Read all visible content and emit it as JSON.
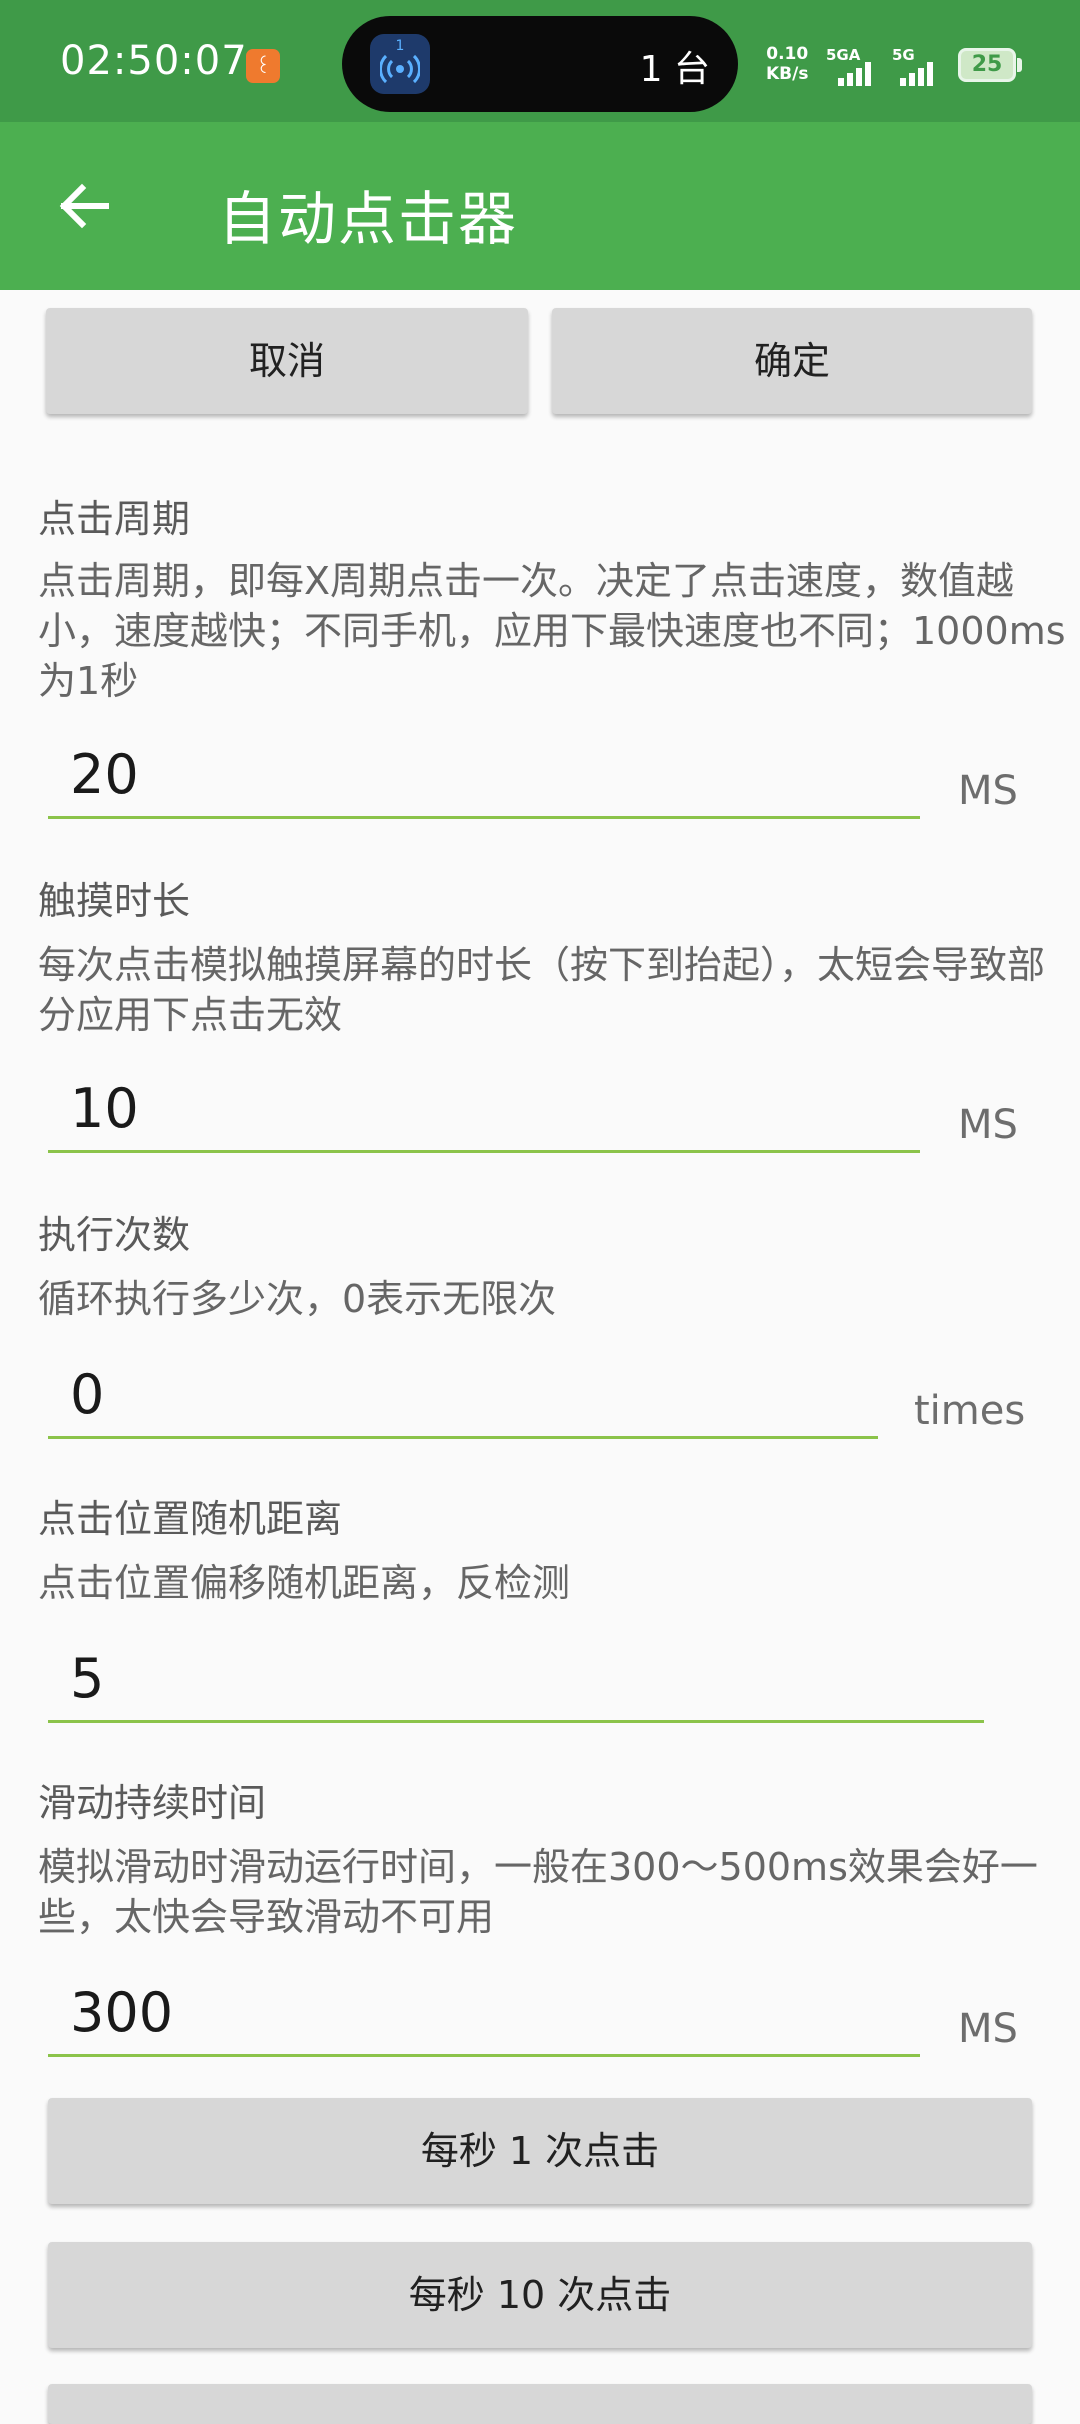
{
  "status_bar": {
    "time": "02:50:07",
    "app_icon_glyph": "꒰",
    "pill_badge": "1",
    "pill_text": "1 台",
    "net_speed_value": "0.10",
    "net_speed_unit": "KB/s",
    "sim1_label": "5GA",
    "sim2_label": "5G",
    "battery": "25"
  },
  "app_bar": {
    "title": "自动点击器",
    "back_icon": "arrow-back-icon"
  },
  "actions": {
    "cancel_label": "取消",
    "ok_label": "确定"
  },
  "settings": {
    "click_period": {
      "label": "点击周期",
      "description": "点击周期，即每X周期点击一次。决定了点击速度，数值越小，速度越快；不同手机，应用下最快速度也不同；1000ms为1秒",
      "value": "20",
      "unit": "MS"
    },
    "touch_duration": {
      "label": "触摸时长",
      "description": "每次点击模拟触摸屏幕的时长（按下到抬起），太短会导致部分应用下点击无效",
      "value": "10",
      "unit": "MS"
    },
    "repeat_count": {
      "label": "执行次数",
      "description": "循环执行多少次，0表示无限次",
      "value": "0",
      "unit": "times"
    },
    "random_offset": {
      "label": "点击位置随机距离",
      "description": "点击位置偏移随机距离，反检测",
      "value": "5"
    },
    "swipe_duration": {
      "label": "滑动持续时间",
      "description": "模拟滑动时滑动运行时间，一般在300～500ms效果会好一些，太快会导致滑动不可用",
      "value": "300",
      "unit": "MS"
    }
  },
  "presets": {
    "one_per_second": "每秒 1 次点击",
    "ten_per_second": "每秒 10 次点击"
  },
  "colors": {
    "status_bar": "#3f9a48",
    "app_bar": "#4caf50",
    "field_underline": "#8bc34a",
    "button_bg": "#d7d7d7"
  }
}
